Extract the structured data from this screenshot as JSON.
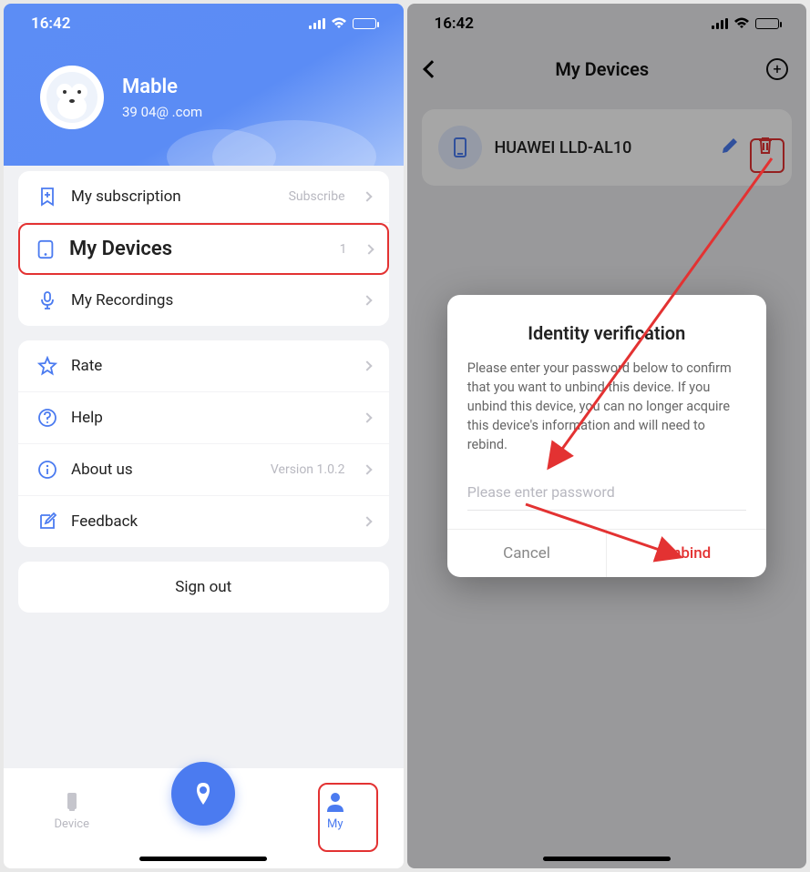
{
  "left": {
    "status": {
      "time": "16:42"
    },
    "profile": {
      "name": "Mable",
      "email": "39     04@   .com"
    },
    "subscription": {
      "label": "My subscription",
      "action": "Subscribe"
    },
    "devices": {
      "label": "My Devices",
      "count": "1"
    },
    "recordings": {
      "label": "My Recordings"
    },
    "rate": {
      "label": "Rate"
    },
    "help": {
      "label": "Help"
    },
    "about": {
      "label": "About us",
      "version": "Version 1.0.2"
    },
    "feedback": {
      "label": "Feedback"
    },
    "signout": "Sign out",
    "nav": {
      "device": "Device",
      "my": "My"
    }
  },
  "right": {
    "status": {
      "time": "16:42"
    },
    "title": "My Devices",
    "device": {
      "name": "HUAWEI LLD-AL10"
    },
    "dialog": {
      "title": "Identity verification",
      "message": "Please enter your password below to confirm that you want to unbind this device. If you unbind this device, you can no longer acquire this device's information and will need to rebind.",
      "placeholder": "Please enter password",
      "cancel": "Cancel",
      "confirm": "Unbind"
    }
  }
}
